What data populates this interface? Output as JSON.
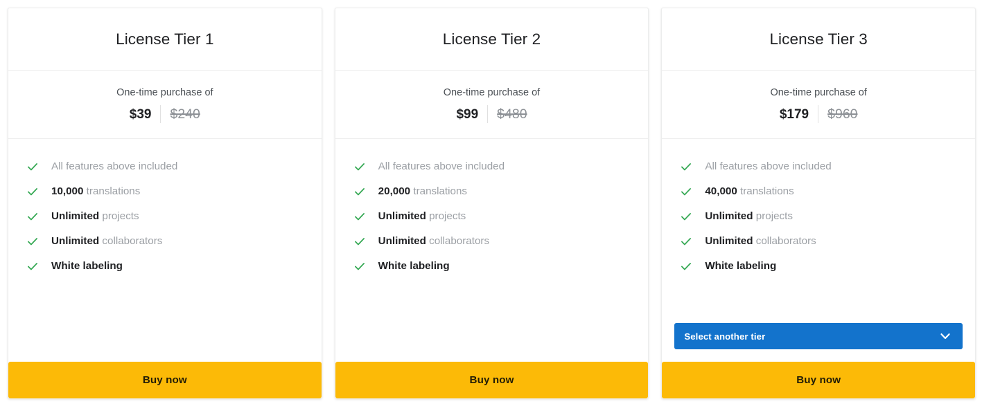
{
  "page": {
    "background": "#ffffff",
    "accent_blue": "#1373cc",
    "accent_yellow": "#fcba07",
    "check_green": "#34a853"
  },
  "tiers": [
    {
      "title": "License Tier 1",
      "price_caption": "One-time purchase of",
      "price_now": "$39",
      "price_was": "$240",
      "features": [
        {
          "strong": "",
          "rest": "All features above included",
          "all_bold": false
        },
        {
          "strong": "10,000",
          "rest": " translations",
          "all_bold": false
        },
        {
          "strong": "Unlimited",
          "rest": " projects",
          "all_bold": false
        },
        {
          "strong": "Unlimited",
          "rest": " collaborators",
          "all_bold": false
        },
        {
          "strong": "",
          "rest": "White labeling",
          "all_bold": true
        }
      ],
      "has_selector": false,
      "selector_label": "",
      "buy_label": "Buy now"
    },
    {
      "title": "License Tier 2",
      "price_caption": "One-time purchase of",
      "price_now": "$99",
      "price_was": "$480",
      "features": [
        {
          "strong": "",
          "rest": "All features above included",
          "all_bold": false
        },
        {
          "strong": "20,000",
          "rest": " translations",
          "all_bold": false
        },
        {
          "strong": "Unlimited",
          "rest": " projects",
          "all_bold": false
        },
        {
          "strong": "Unlimited",
          "rest": " collaborators",
          "all_bold": false
        },
        {
          "strong": "",
          "rest": "White labeling",
          "all_bold": true
        }
      ],
      "has_selector": false,
      "selector_label": "",
      "buy_label": "Buy now"
    },
    {
      "title": "License Tier 3",
      "price_caption": "One-time purchase of",
      "price_now": "$179",
      "price_was": "$960",
      "features": [
        {
          "strong": "",
          "rest": "All features above included",
          "all_bold": false
        },
        {
          "strong": "40,000",
          "rest": " translations",
          "all_bold": false
        },
        {
          "strong": "Unlimited",
          "rest": " projects",
          "all_bold": false
        },
        {
          "strong": "Unlimited",
          "rest": " collaborators",
          "all_bold": false
        },
        {
          "strong": "",
          "rest": "White labeling",
          "all_bold": true
        }
      ],
      "has_selector": true,
      "selector_label": "Select another tier",
      "buy_label": "Buy now"
    }
  ],
  "icons": {
    "check": "check-icon",
    "chevron_down": "chevron-down-icon"
  }
}
